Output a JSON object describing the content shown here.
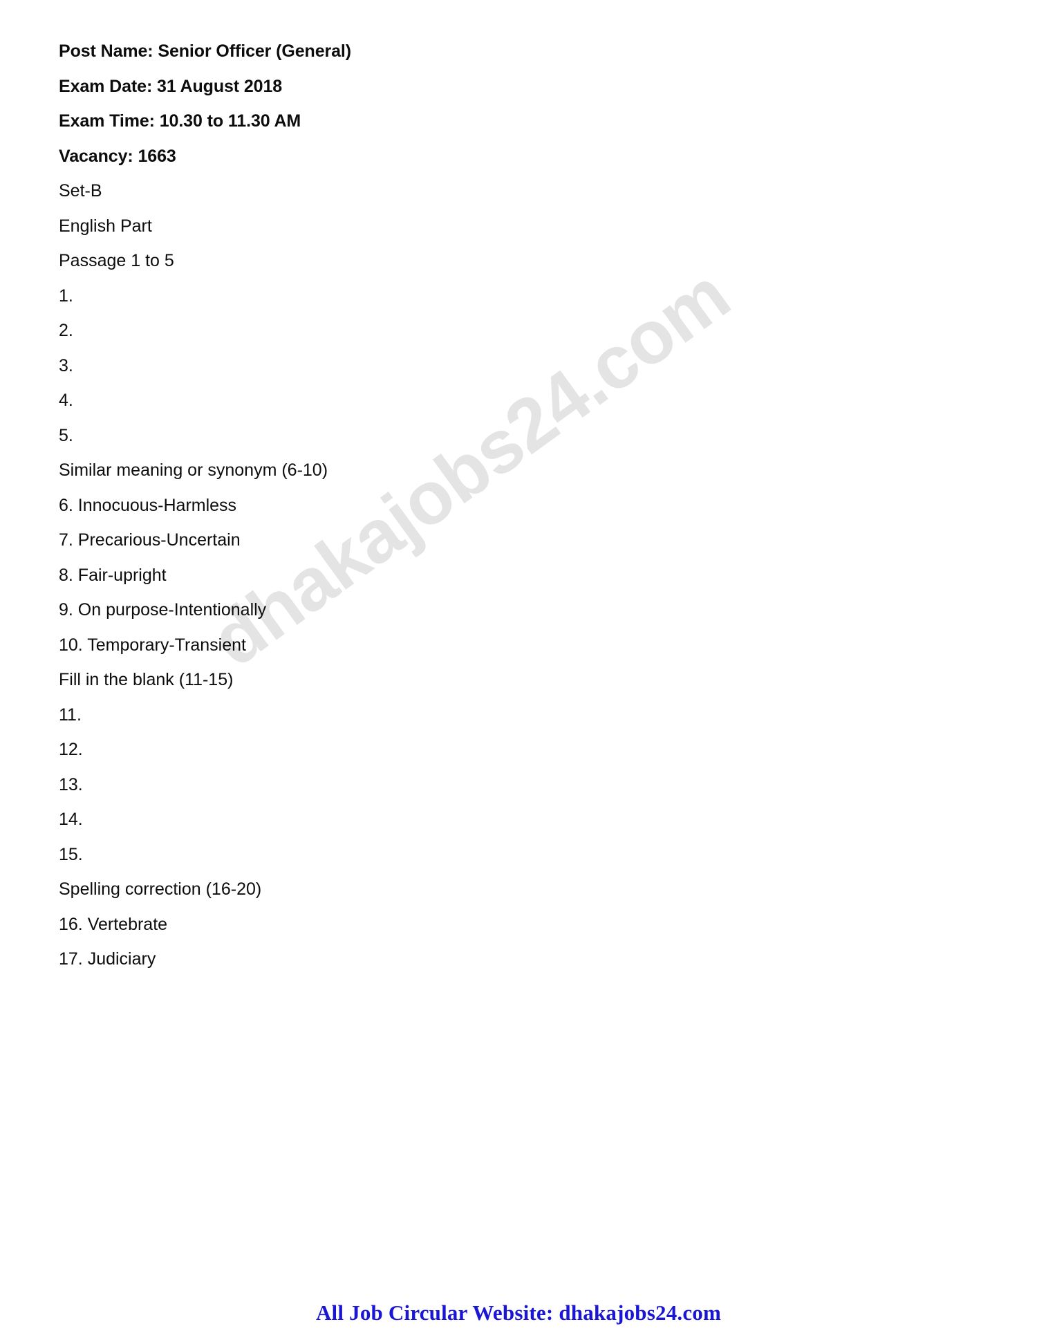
{
  "document": {
    "watermark": "dhakajobs24.com",
    "header_lines": [
      {
        "text": "Post Name: Senior Officer (General)",
        "bold": true
      },
      {
        "text": "Exam Date: 31 August 2018",
        "bold": true
      },
      {
        "text": "Exam Time: 10.30 to 11.30 AM",
        "bold": true
      },
      {
        "text": "Vacancy: 1663",
        "bold": true
      }
    ],
    "body_lines": [
      {
        "text": "Set-B",
        "bold": false
      },
      {
        "text": "English Part",
        "bold": false
      },
      {
        "text": "Passage 1 to 5",
        "bold": false
      },
      {
        "text": "1.",
        "bold": false
      },
      {
        "text": "2.",
        "bold": false
      },
      {
        "text": "3.",
        "bold": false
      },
      {
        "text": "4.",
        "bold": false
      },
      {
        "text": "5.",
        "bold": false
      },
      {
        "text": "Similar meaning or synonym (6-10)",
        "bold": false
      },
      {
        "text": "6. Innocuous-Harmless",
        "bold": false
      },
      {
        "text": "7. Precarious-Uncertain",
        "bold": false
      },
      {
        "text": "8. Fair-upright",
        "bold": false
      },
      {
        "text": "9. On purpose-Intentionally",
        "bold": false
      },
      {
        "text": "10. Temporary-Transient",
        "bold": false
      },
      {
        "text": "Fill in the blank (11-15)",
        "bold": false
      },
      {
        "text": "11.",
        "bold": false
      },
      {
        "text": "12.",
        "bold": false
      },
      {
        "text": "13.",
        "bold": false
      },
      {
        "text": "14.",
        "bold": false
      },
      {
        "text": "15.",
        "bold": false
      },
      {
        "text": "Spelling correction (16-20)",
        "bold": false
      },
      {
        "text": "16. Vertebrate",
        "bold": false
      },
      {
        "text": "17. Judiciary",
        "bold": false
      }
    ],
    "footer": {
      "text": "All Job Circular Website: dhakajobs24.com",
      "color": "#1a16d4"
    }
  }
}
